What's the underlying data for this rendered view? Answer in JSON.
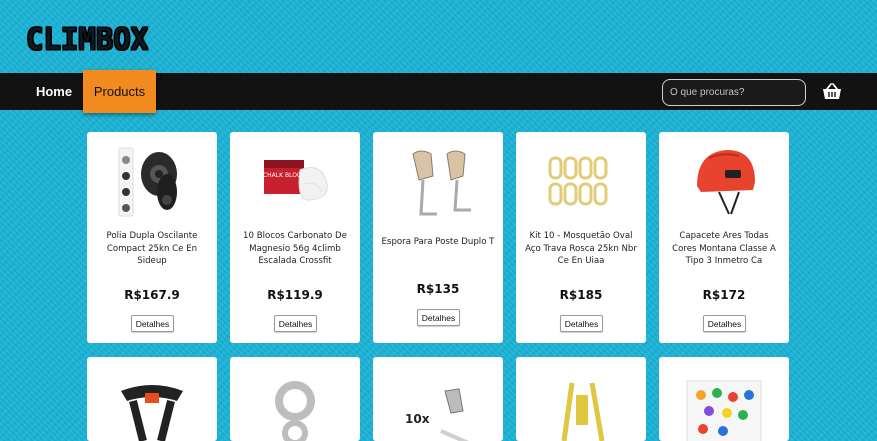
{
  "brand": {
    "logo": "CLIMBOX"
  },
  "nav": {
    "home": "Home",
    "products": "Products",
    "search_placeholder": "O que procuras?"
  },
  "products": [
    {
      "title": "Polia Dupla Oscilante Compact 25kn Ce En Sideup",
      "price": "R$167.9",
      "button": "Detalhes"
    },
    {
      "title": "10 Blocos Carbonato De Magnesio 56g 4climb Escalada Crossfit",
      "price": "R$119.9",
      "button": "Detalhes"
    },
    {
      "title": "Espora Para Poste Duplo T",
      "price": "R$135",
      "button": "Detalhes"
    },
    {
      "title": "Kit 10 - Mosquetão Oval Aço Trava Rosca 25kn Nbr Ce En Uiaa",
      "price": "R$185",
      "button": "Detalhes"
    },
    {
      "title": "Capacete Ares Todas Cores Montana Classe A Tipo 3 Inmetro Ca",
      "price": "R$172",
      "button": "Detalhes"
    }
  ],
  "second_row_images": [
    "harness-image",
    "figure-eight-descender-image",
    "hold-kit-image",
    "lanyard-image",
    "climbing-holds-image"
  ],
  "image_labels": {
    "hold_kit_count": "10x",
    "chalk_bag": "CHALK BLOCK"
  },
  "colors": {
    "background": "#1ab3d6",
    "navbar": "#121212",
    "active_tab": "#f28b1f"
  }
}
